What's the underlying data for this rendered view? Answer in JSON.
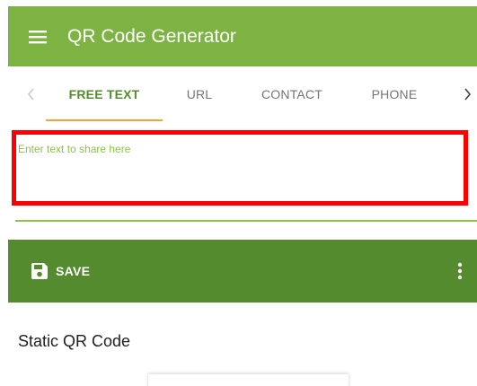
{
  "appbar": {
    "title": "QR Code Generator",
    "menu_icon": "menu-icon"
  },
  "tabs": {
    "prev_icon": "chevron-left-icon",
    "next_icon": "chevron-right-icon",
    "items": [
      {
        "label": "FREE TEXT",
        "active": true
      },
      {
        "label": "URL",
        "active": false
      },
      {
        "label": "CONTACT",
        "active": false
      },
      {
        "label": "PHONE",
        "active": false
      }
    ]
  },
  "free_text": {
    "placeholder": "Enter text to share here",
    "value": ""
  },
  "toolbar": {
    "save_label": "SAVE",
    "save_icon": "floppy-disk-icon",
    "more_icon": "more-vert-icon"
  },
  "qr_section": {
    "title": "Static QR Code"
  },
  "colors": {
    "appbar": "#7cb342",
    "toolbar": "#558b2f",
    "active_tab": "#558b2f",
    "tab_indicator": "#f0a33a",
    "highlight_border": "#ff0000"
  }
}
